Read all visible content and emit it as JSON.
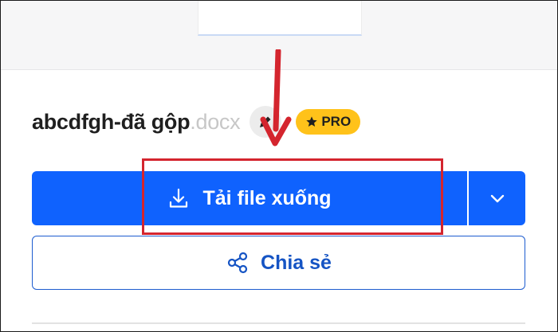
{
  "file": {
    "name": "abcdfgh-đã gộp",
    "extension": ".docx",
    "edit_icon": "pencil-icon",
    "pro_badge": {
      "icon": "star-icon",
      "label": "PRO",
      "color": "#ffc21a"
    }
  },
  "actions": {
    "download": {
      "label": "Tải file xuống",
      "icon": "download-icon",
      "dropdown_icon": "chevron-down-icon",
      "color": "#0f62fe"
    },
    "share": {
      "label": "Chia sẻ",
      "icon": "share-icon",
      "color": "#1554c4"
    }
  },
  "annotation": {
    "color": "#d4252e"
  }
}
